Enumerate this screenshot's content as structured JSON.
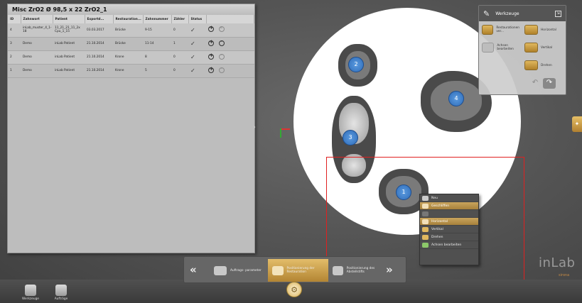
{
  "table_panel": {
    "title": "Misc ZrO2 Ø 98,5 x 22 ZrO2_1",
    "columns": [
      "ID",
      "Zahnwort",
      "Patient",
      "Exportd...",
      "Restauration...",
      "Zahnnummer",
      "Zähler",
      "Status"
    ],
    "rows": [
      {
        "id": "4",
        "zahnwort": "inLab_muster_4_1-18",
        "patient": "11_21_21_11_2x Cpu_1_15",
        "export": "03.03.2017",
        "restauration": "Brücke",
        "zahnnummer": "9-15",
        "zaehler": "0",
        "status": "✓"
      },
      {
        "id": "3",
        "zahnwort": "Demo",
        "patient": "inLab Patient",
        "export": "21.10.2014",
        "restauration": "Brücke",
        "zahnnummer": "11-14",
        "zaehler": "1",
        "status": "✓"
      },
      {
        "id": "2",
        "zahnwort": "Demo",
        "patient": "inLab Patient",
        "export": "21.10.2014",
        "restauration": "Krone",
        "zahnnummer": "8",
        "zaehler": "0",
        "status": "✓"
      },
      {
        "id": "1",
        "zahnwort": "Demo",
        "patient": "inLab Patient",
        "export": "21.10.2014",
        "restauration": "Krone",
        "zahnnummer": "5",
        "zaehler": "0",
        "status": "✓"
      }
    ]
  },
  "restorations": {
    "badge_1": "1",
    "badge_2": "2",
    "badge_3": "3",
    "badge_4": "4"
  },
  "context_menu": {
    "items": [
      "Neu",
      "Geschliffen",
      "",
      "Horizontal",
      "Vertikal",
      "Drehen",
      "Achsen bearbeiten"
    ]
  },
  "tools_panel": {
    "title": "Werkzeuge",
    "buttons": {
      "restoration_reset": "Restaurationen ver...",
      "horizontal": "Horizontal",
      "edit_axes": "Achsen bearbeiten",
      "vertical": "Vertikal",
      "rotate": "Drehen"
    }
  },
  "workflow": {
    "step_1": "Auftrags- parameter",
    "step_2": "Positionierung der Restauration",
    "step_3": "Positionierung des Abstellstifts"
  },
  "bottom_toolbar": {
    "tools": "Werkzeuge",
    "jobs": "Aufträge"
  },
  "brand": {
    "name": "inLab",
    "sub": "sirona"
  },
  "colors": {
    "accent": "#c8a050",
    "badge_blue": "#3f7fcc",
    "selection_red": "#e02020"
  }
}
